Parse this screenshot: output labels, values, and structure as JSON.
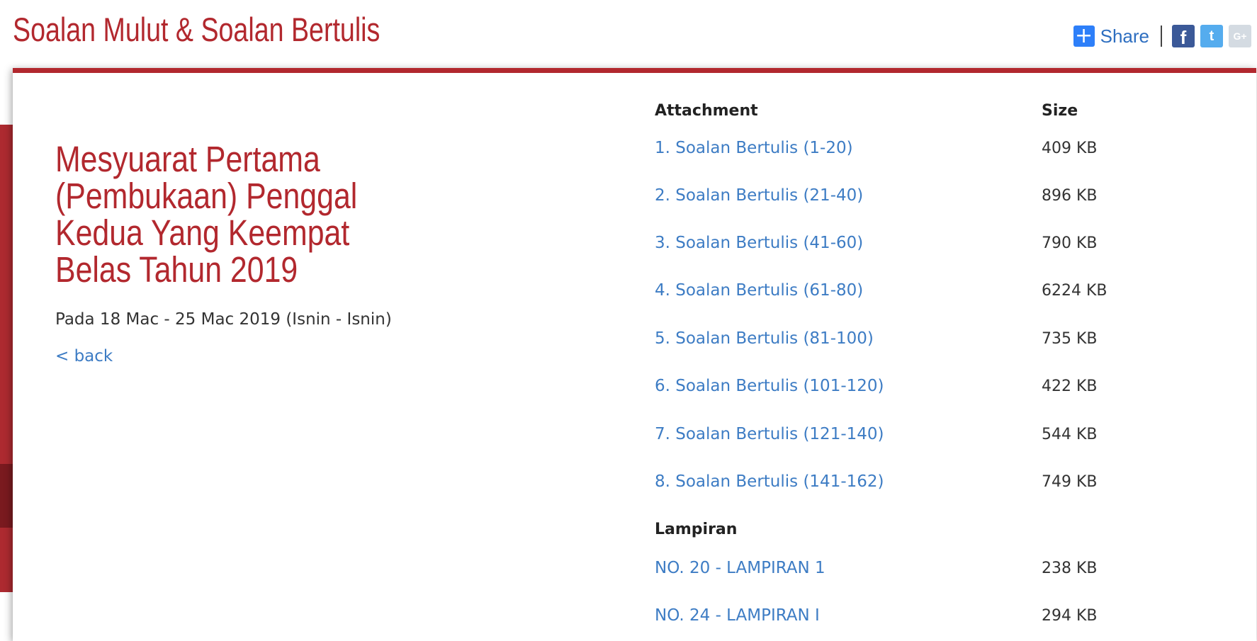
{
  "header": {
    "title": "Soalan Mulut & Soalan Bertulis",
    "share": {
      "label": "Share",
      "plus_glyph": "+",
      "facebook_glyph": "f",
      "twitter_glyph": "t",
      "googleplus_glyph": "G+"
    }
  },
  "meeting": {
    "title": "Mesyuarat Pertama (Pembukaan) Penggal Kedua Yang Keempat Belas Tahun 2019",
    "date": "Pada 18 Mac - 25 Mac 2019 (Isnin - Isnin)",
    "back_label": "< back"
  },
  "table": {
    "attachment_header": "Attachment",
    "size_header": "Size",
    "attachments": [
      {
        "name": "1. Soalan Bertulis (1-20)",
        "size": "409 KB"
      },
      {
        "name": "2. Soalan Bertulis (21-40)",
        "size": "896 KB"
      },
      {
        "name": "3. Soalan Bertulis (41-60)",
        "size": "790 KB"
      },
      {
        "name": "4. Soalan Bertulis (61-80)",
        "size": "6224 KB"
      },
      {
        "name": "5. Soalan Bertulis (81-100)",
        "size": "735 KB"
      },
      {
        "name": "6. Soalan Bertulis (101-120)",
        "size": "422 KB"
      },
      {
        "name": "7. Soalan Bertulis (121-140)",
        "size": "544 KB"
      },
      {
        "name": "8. Soalan Bertulis (141-162)",
        "size": "749 KB"
      }
    ],
    "lampiran_header": "Lampiran",
    "lampiran": [
      {
        "name": "NO. 20 - LAMPIRAN 1",
        "size": "238 KB"
      },
      {
        "name": "NO. 24 - LAMPIRAN I",
        "size": "294 KB"
      }
    ]
  },
  "colors": {
    "brand_red": "#b2282e",
    "link_blue": "#3d7cc4",
    "facebook": "#3b5998",
    "twitter": "#55acee",
    "share_blue": "#2d7ff9"
  }
}
